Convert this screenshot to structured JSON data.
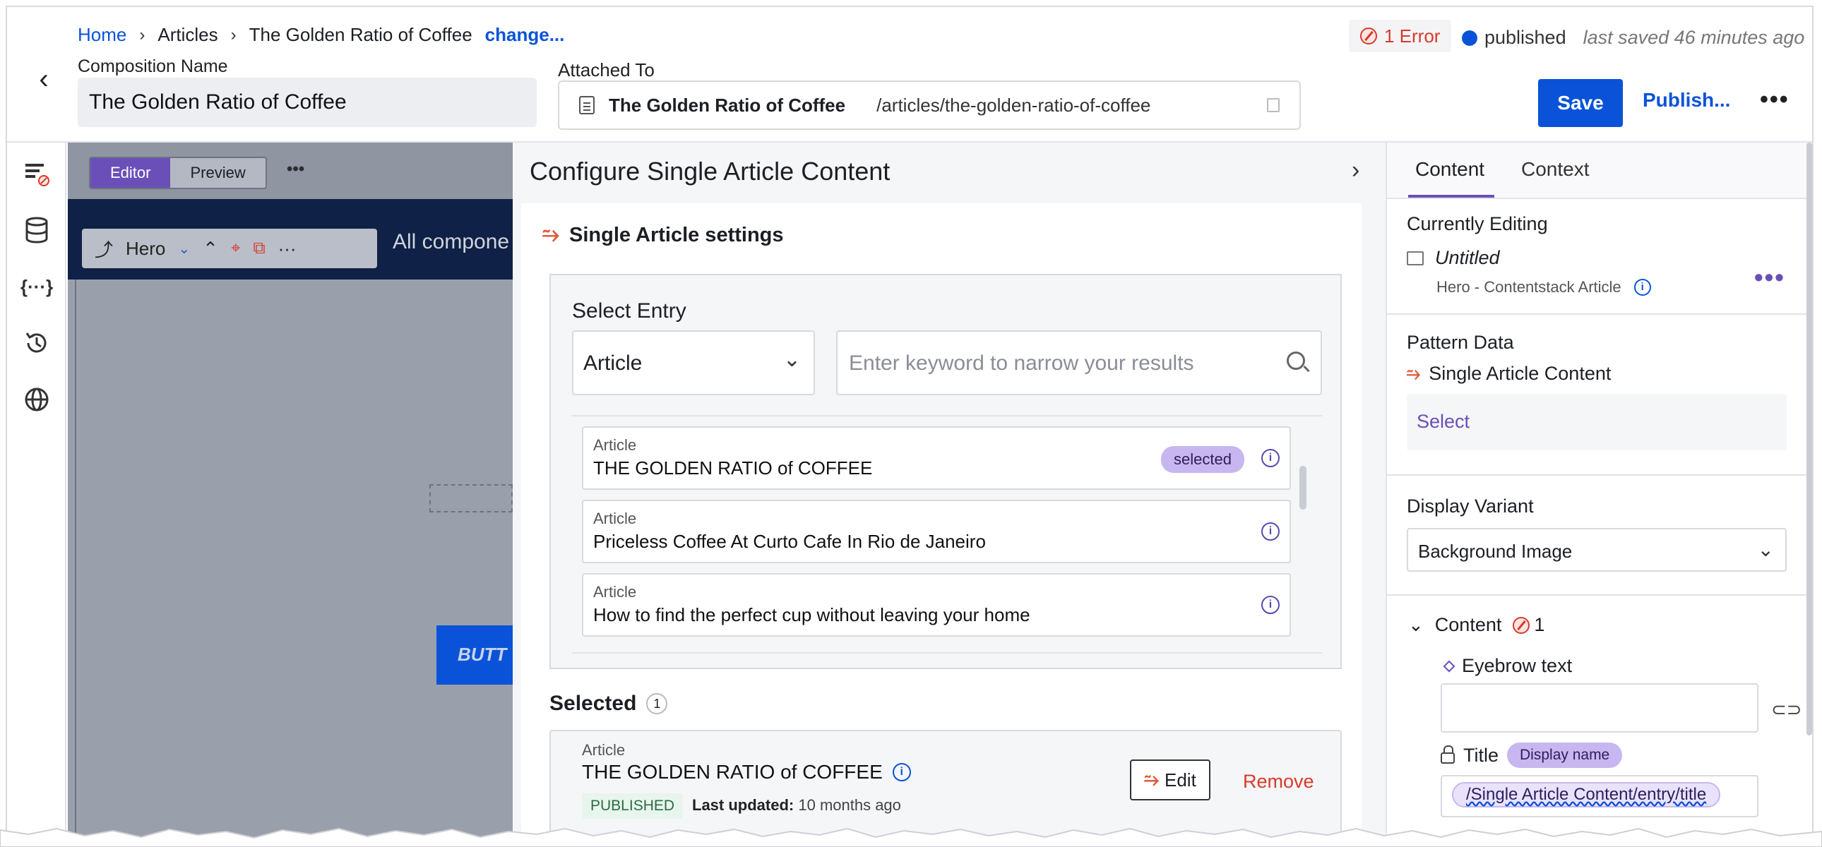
{
  "breadcrumb": {
    "home": "Home",
    "articles": "Articles",
    "current": "The Golden Ratio of Coffee",
    "change": "change..."
  },
  "composition": {
    "label": "Composition Name",
    "value": "The Golden Ratio of Coffee"
  },
  "attached": {
    "label": "Attached To",
    "name": "The Golden Ratio of Coffee",
    "path": "/articles/the-golden-ratio-of-coffee"
  },
  "status": {
    "error": "1 Error",
    "published": "published",
    "saved": "last saved 46 minutes ago"
  },
  "actions": {
    "save": "Save",
    "publish": "Publish...",
    "more": "•••"
  },
  "canvas": {
    "editor": "Editor",
    "preview": "Preview",
    "more": "•••",
    "hero_label": "Hero",
    "band_text": "All compone",
    "button_text": "BUTT"
  },
  "config": {
    "title": "Configure Single Article Content",
    "settings_title": "Single Article settings",
    "select_entry": "Select Entry",
    "type": "Article",
    "search_placeholder": "Enter keyword to narrow your results",
    "entries": [
      {
        "type": "Article",
        "name": "THE GOLDEN RATIO of COFFEE",
        "badge": "selected"
      },
      {
        "type": "Article",
        "name": "Priceless Coffee At Curto Cafe In Rio de Janeiro"
      },
      {
        "type": "Article",
        "name": "How to find the perfect cup without leaving your home"
      }
    ],
    "selected_heading": "Selected",
    "selected_count": "1",
    "selected": {
      "type": "Article",
      "name": "THE GOLDEN RATIO of COFFEE",
      "status": "PUBLISHED",
      "updated_label": "Last updated:",
      "updated_value": "10 months ago",
      "edit": "Edit",
      "remove": "Remove"
    }
  },
  "right": {
    "tabs": [
      "Content",
      "Context"
    ],
    "currently_editing": "Currently Editing",
    "component_name": "Untitled",
    "component_sub": "Hero - Contentstack Article",
    "pattern_data": "Pattern Data",
    "pattern_name": "Single Article Content",
    "pattern_select": "Select",
    "display_variant": "Display Variant",
    "variant_value": "Background Image",
    "content_label": "Content",
    "content_errors": "1",
    "eyebrow": "Eyebrow text",
    "title": "Title",
    "display_name": "Display name",
    "title_binding": "/Single Article Content/entry/title"
  }
}
